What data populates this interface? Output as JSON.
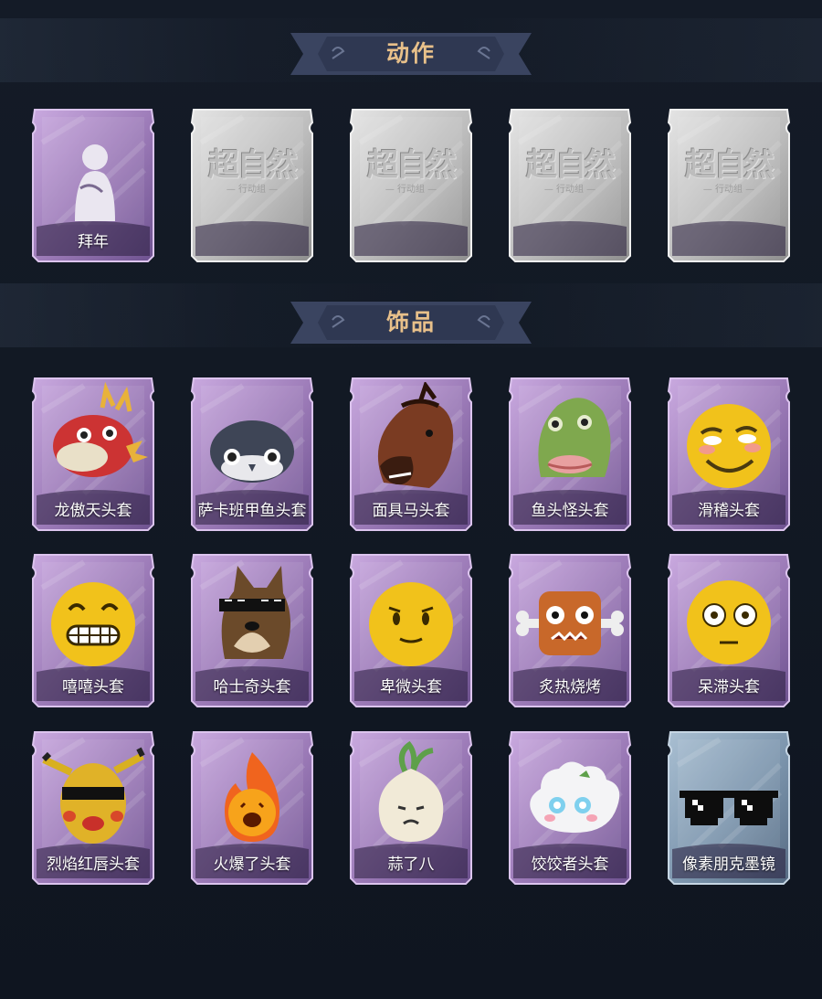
{
  "sections": {
    "actions": {
      "title": "动作"
    },
    "accessories": {
      "title": "饰品"
    }
  },
  "actions": [
    {
      "label": "拜年",
      "icon": "bow-greeting-pose-icon",
      "state": "unlocked"
    },
    {
      "label": "",
      "state": "locked",
      "placeholder_title": "超自然",
      "placeholder_sub": "— 行动组 —"
    },
    {
      "label": "",
      "state": "locked",
      "placeholder_title": "超自然",
      "placeholder_sub": "— 行动组 —"
    },
    {
      "label": "",
      "state": "locked",
      "placeholder_title": "超自然",
      "placeholder_sub": "— 行动组 —"
    },
    {
      "label": "",
      "state": "locked",
      "placeholder_title": "超自然",
      "placeholder_sub": "— 行动组 —"
    }
  ],
  "accessories": [
    {
      "label": "龙傲天头套",
      "icon": "dragon-head-icon",
      "rarity": "purple"
    },
    {
      "label": "萨卡班甲鱼头套",
      "icon": "fish-head-icon",
      "rarity": "purple"
    },
    {
      "label": "面具马头套",
      "icon": "horse-mask-icon",
      "rarity": "purple"
    },
    {
      "label": "鱼头怪头套",
      "icon": "fish-monster-head-icon",
      "rarity": "purple"
    },
    {
      "label": "滑稽头套",
      "icon": "funny-face-icon",
      "rarity": "purple"
    },
    {
      "label": "嘻嘻头套",
      "icon": "grin-face-icon",
      "rarity": "purple"
    },
    {
      "label": "哈士奇头套",
      "icon": "husky-head-icon",
      "rarity": "purple"
    },
    {
      "label": "卑微头套",
      "icon": "humble-face-icon",
      "rarity": "purple"
    },
    {
      "label": "炙热烧烤",
      "icon": "meat-bone-icon",
      "rarity": "purple"
    },
    {
      "label": "呆滞头套",
      "icon": "dazed-face-icon",
      "rarity": "purple"
    },
    {
      "label": "烈焰红唇头套",
      "icon": "yellow-mask-sunglasses-icon",
      "rarity": "purple"
    },
    {
      "label": "火爆了头套",
      "icon": "fireball-icon",
      "rarity": "purple"
    },
    {
      "label": "蒜了八",
      "icon": "garlic-icon",
      "rarity": "purple"
    },
    {
      "label": "饺饺者头套",
      "icon": "dumpling-icon",
      "rarity": "purple"
    },
    {
      "label": "像素朋克墨镜",
      "icon": "pixel-sunglasses-icon",
      "rarity": "blue"
    }
  ],
  "colors": {
    "background": "#121924",
    "purple_card": "#9a7bb4",
    "blue_card": "#7f98ae",
    "locked_card": "#bdbdbd",
    "banner": "#3a4460",
    "banner_text": "#e8c08a"
  }
}
